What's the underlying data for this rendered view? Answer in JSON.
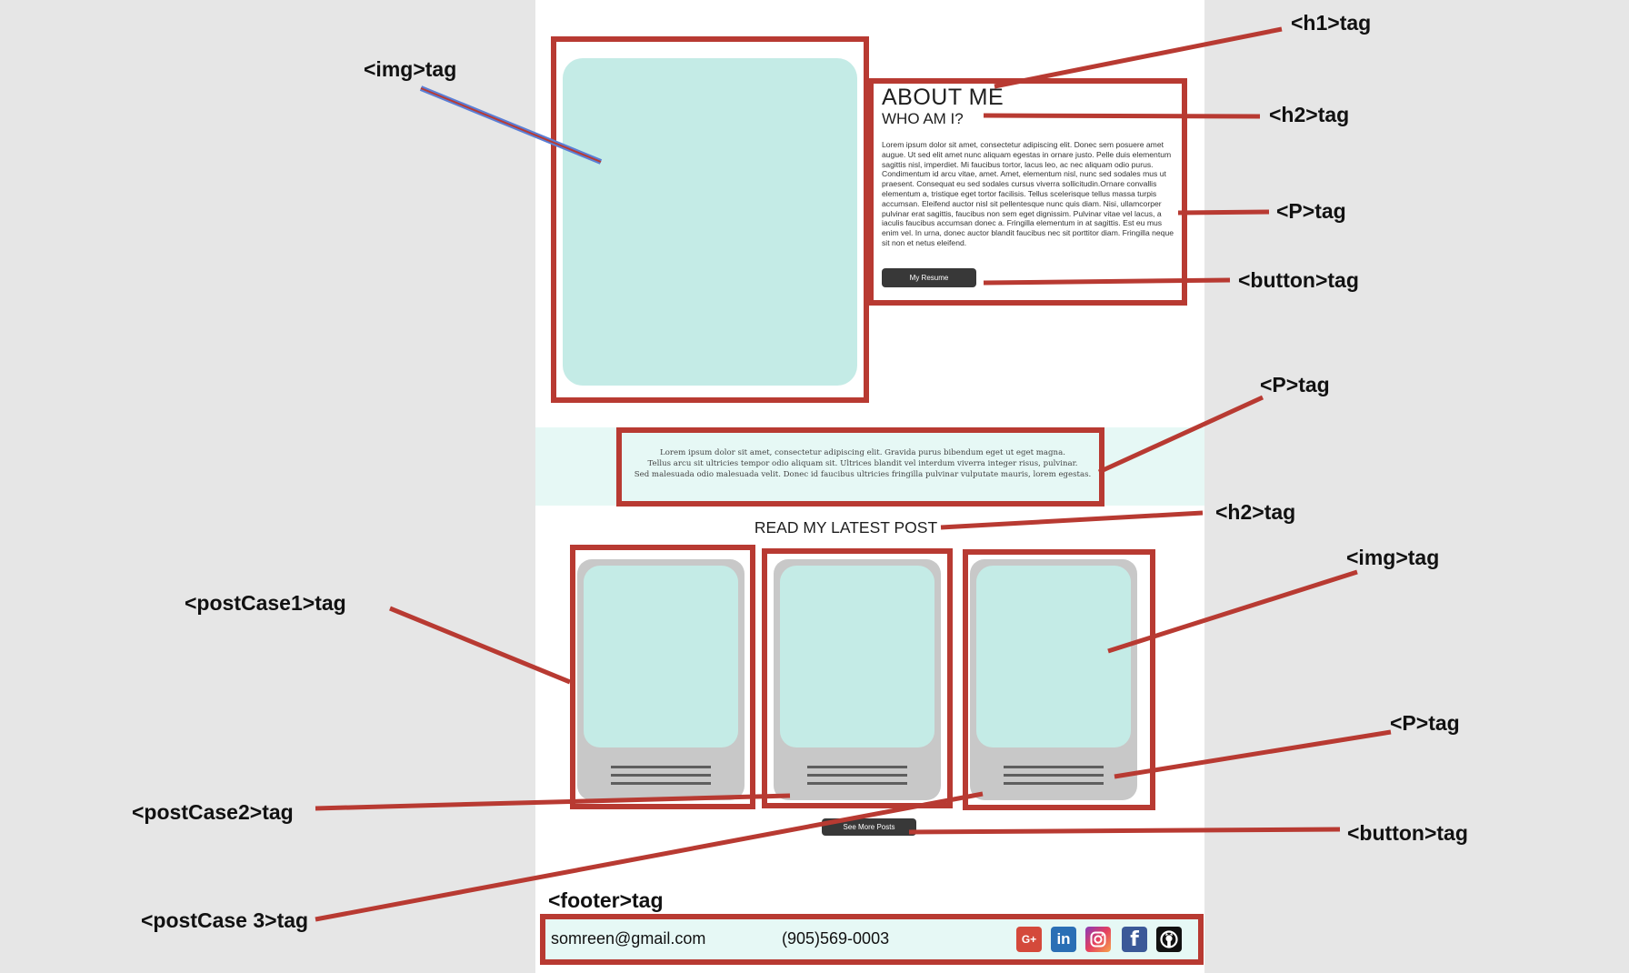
{
  "about": {
    "h1": "ABOUT ME",
    "h2": "WHO AM I?",
    "paragraph": "Lorem ipsum dolor sit amet, consectetur adipiscing elit. Donec sem posuere amet augue. Ut sed elit amet nunc aliquam egestas in ornare justo. Pelle duis elementum sagittis nisl, imperdiet. Mi faucibus tortor, lacus leo, ac nec aliquam odio purus. Condimentum id arcu vitae, amet. Amet, elementum nisl, nunc sed sodales mus ut praesent. Consequat eu sed sodales cursus viverra sollicitudin.Ornare convallis elementum a, tristique eget tortor facilisis. Tellus scelerisque tellus massa turpis accumsan. Eleifend auctor nisl sit pellentesque nunc quis diam. Nisi, ullamcorper pulvinar erat sagittis, faucibus non sem eget dignissim. Pulvinar vitae vel lacus, a iaculis faucibus accumsan donec a. Fringilla elementum in at sagittis. Est eu mus enim vel. In urna, donec auctor blandit faucibus nec sit porttitor diam. Fringilla neque sit non et netus eleifend.",
    "button": "My Resume"
  },
  "quote": {
    "line1": "Lorem ipsum dolor sit amet, consectetur adipiscing elit. Gravida purus bibendum eget ut eget magna.",
    "line2": "Tellus arcu sit ultricies tempor odio aliquam sit. Ultrices blandit vel interdum viverra integer risus, pulvinar.",
    "line3": "Sed malesuada odio malesuada velit. Donec id faucibus ultricies fringilla pulvinar vulputate mauris, lorem egestas."
  },
  "posts": {
    "heading": "READ MY LATEST POST",
    "button": "See More Posts"
  },
  "footer": {
    "email": "somreen@gmail.com",
    "phone": "(905)569-0003",
    "icons": [
      "google-plus-icon",
      "linkedin-icon",
      "instagram-icon",
      "facebook-icon",
      "github-icon"
    ],
    "icon_glyphs": {
      "google": "G+",
      "linkedin": "in",
      "facebook": "f"
    }
  },
  "annotations": {
    "img_top": "<img>tag",
    "h1": "<h1>tag",
    "h2_top": "<h2>tag",
    "p_top": "<P>tag",
    "button_top": "<button>tag",
    "p_band": "<P>tag",
    "h2_posts": "<h2>tag",
    "img_post": "<img>tag",
    "postcase1": "<postCase1>tag",
    "p_post": "<P>tag",
    "postcase2": "<postCase2>tag",
    "button_posts": "<button>tag",
    "footer": "<footer>tag",
    "postcase3": "<postCase 3>tag"
  },
  "colors": {
    "background": "#e6e6e6",
    "page": "#ffffff",
    "annotation_red": "#b83a32",
    "image_placeholder": "#c4ebe6",
    "band": "#e6f8f5",
    "card": "#c8c8c8",
    "button": "#383838",
    "leader_blue": "#5a7fd6"
  }
}
